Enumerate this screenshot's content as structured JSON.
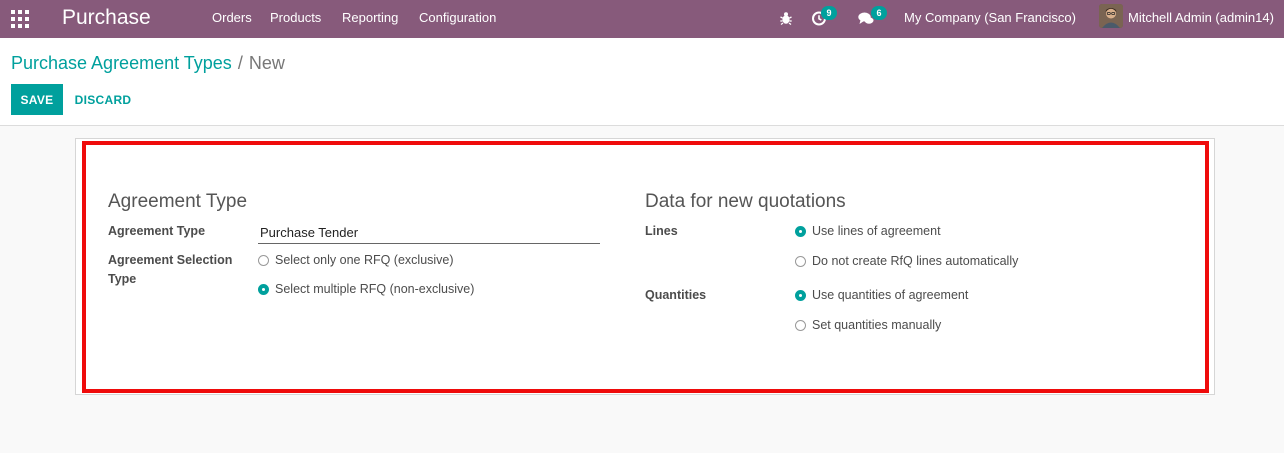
{
  "navbar": {
    "app_title": "Purchase",
    "menu": [
      "Orders",
      "Products",
      "Reporting",
      "Configuration"
    ],
    "activity_count": "9",
    "messages_count": "6",
    "company": "My Company (San Francisco)",
    "user": "Mitchell Admin (admin14)",
    "bg_color": "#875a7b"
  },
  "breadcrumb": {
    "parent": "Purchase Agreement Types",
    "separator": "/",
    "current": "New"
  },
  "buttons": {
    "save": "SAVE",
    "discard": "DISCARD"
  },
  "form": {
    "left_group": {
      "title": "Agreement Type",
      "agreement_type_label": "Agreement Type",
      "agreement_type_value": "Purchase Tender",
      "selection_label_line1": "Agreement Selection",
      "selection_label_line2": "Type",
      "selection_options": [
        {
          "label": "Select only one RFQ (exclusive)",
          "checked": false
        },
        {
          "label": "Select multiple RFQ (non-exclusive)",
          "checked": true
        }
      ]
    },
    "right_group": {
      "title": "Data for new quotations",
      "lines_label": "Lines",
      "lines_options": [
        {
          "label": "Use lines of agreement",
          "checked": true
        },
        {
          "label": "Do not create RfQ lines automatically",
          "checked": false
        }
      ],
      "quantities_label": "Quantities",
      "quantities_options": [
        {
          "label": "Use quantities of agreement",
          "checked": true
        },
        {
          "label": "Set quantities manually",
          "checked": false
        }
      ]
    }
  },
  "colors": {
    "accent": "#00a09d",
    "highlight": "#ef0b0b"
  }
}
